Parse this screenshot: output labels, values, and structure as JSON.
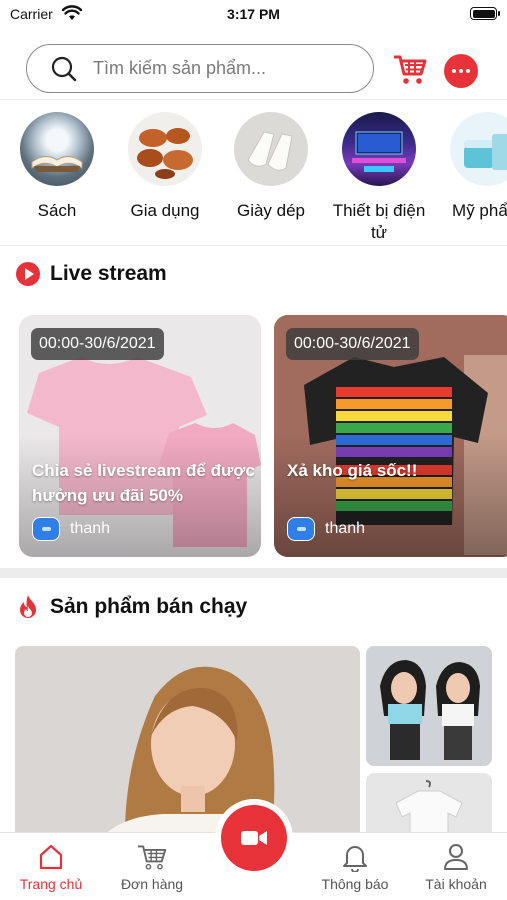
{
  "status_bar": {
    "carrier": "Carrier",
    "time": "3:17 PM"
  },
  "search": {
    "placeholder": "Tìm kiếm sản phẩm..."
  },
  "categories": [
    {
      "label": "Sách",
      "icon": "book-image"
    },
    {
      "label": "Gia dụng",
      "icon": "cookware-image"
    },
    {
      "label": "Giày dép",
      "icon": "shoes-image"
    },
    {
      "label": "Thiết bị điện tử",
      "icon": "electronics-image"
    },
    {
      "label": "Mỹ phẩm",
      "icon": "cosmetics-image"
    }
  ],
  "live_section": {
    "title": "Live stream",
    "cards": [
      {
        "time": "00:00-30/6/2021",
        "title": "Chia sẻ livestream để được hưởng ưu đãi 50%",
        "user": "thanh"
      },
      {
        "time": "00:00-30/6/2021",
        "title": "Xả kho giá sốc!!",
        "user": "thanh"
      }
    ]
  },
  "best_section": {
    "title": "Sản phẩm bán chạy"
  },
  "nav": {
    "items": [
      {
        "label": "Trang chủ",
        "icon": "home-icon",
        "active": true
      },
      {
        "label": "Đơn hàng",
        "icon": "cart-icon",
        "active": false
      },
      {
        "label": "Thông báo",
        "icon": "bell-icon",
        "active": false
      },
      {
        "label": "Tài khoản",
        "icon": "user-icon",
        "active": false
      }
    ],
    "center_button_icon": "video-camera-icon"
  },
  "colors": {
    "accent": "#e8323a",
    "text": "#111111",
    "muted": "#555555"
  }
}
